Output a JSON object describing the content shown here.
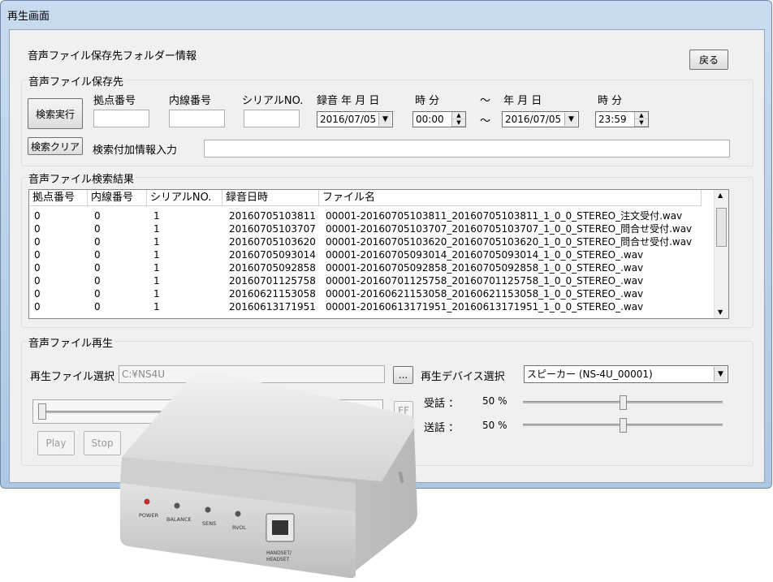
{
  "window": {
    "title": "再生画面"
  },
  "header": {
    "folder_info_label": "音声ファイル保存先フォルダー情報",
    "back_button": "戻る"
  },
  "search": {
    "group_label": "音声ファイル保存先",
    "search_button": "検索実行",
    "clear_button": "検索クリア",
    "base_no_label": "拠点番号",
    "ext_no_label": "内線番号",
    "serial_label": "シリアルNO.",
    "rec_date_label": "録音 年 月 日",
    "hm_label_1": "時 分",
    "tilde_1": "～",
    "date_label_2": "年 月 日",
    "hm_label_2": "時 分",
    "tilde_2": "～",
    "date_from": "2016/07/05",
    "time_from": "00:00",
    "date_to": "2016/07/05",
    "time_to": "23:59",
    "extra_info_label": "検索付加情報入力",
    "extra_info_value": ""
  },
  "results": {
    "group_label": "音声ファイル検索結果",
    "columns": [
      "拠点番号",
      "内線番号",
      "シリアルNO.",
      "録音日時",
      "ファイル名"
    ],
    "rows": [
      [
        "0",
        "0",
        "1",
        "20160705103811",
        "00001-20160705103811_20160705103811_1_0_0_STEREO_注文受付.wav"
      ],
      [
        "0",
        "0",
        "1",
        "20160705103707",
        "00001-20160705103707_20160705103707_1_0_0_STEREO_問合せ受付.wav"
      ],
      [
        "0",
        "0",
        "1",
        "20160705103620",
        "00001-20160705103620_20160705103620_1_0_0_STEREO_問合せ受付.wav"
      ],
      [
        "0",
        "0",
        "1",
        "20160705093014",
        "00001-20160705093014_20160705093014_1_0_0_STEREO_.wav"
      ],
      [
        "0",
        "0",
        "1",
        "20160705092858",
        "00001-20160705092858_20160705092858_1_0_0_STEREO_.wav"
      ],
      [
        "0",
        "0",
        "1",
        "20160701125758",
        "00001-20160701125758_20160701125758_1_0_0_STEREO_.wav"
      ],
      [
        "0",
        "0",
        "1",
        "20160621153058",
        "00001-20160621153058_20160621153058_1_0_0_STEREO_.wav"
      ],
      [
        "0",
        "0",
        "1",
        "20160613171951",
        "00001-20160613171951_20160613171951_1_0_0_STEREO_.wav"
      ]
    ]
  },
  "playback": {
    "group_label": "音声ファイル再生",
    "file_select_label": "再生ファイル選択",
    "file_path": "C:¥NS4U",
    "browse_button": "...",
    "device_select_label": "再生デバイス選択",
    "device_value": "スピーカー (NS-4U_00001)",
    "ff_button": "FF",
    "play_button": "Play",
    "stop_button": "Stop",
    "receive_label": "受話 ：",
    "receive_value": "50 %",
    "send_label": "送話 ：",
    "send_value": "50 %",
    "receive_level": 0.5,
    "send_level": 0.5,
    "seek_position": 0.0
  },
  "device_photo": {
    "labels": [
      "POWER",
      "BALANCE",
      "SENS",
      "RVOL",
      "HANDSET/\nHEADSET"
    ],
    "colors": {
      "body": "#dcdcdc",
      "power_led": "#c03030"
    }
  }
}
